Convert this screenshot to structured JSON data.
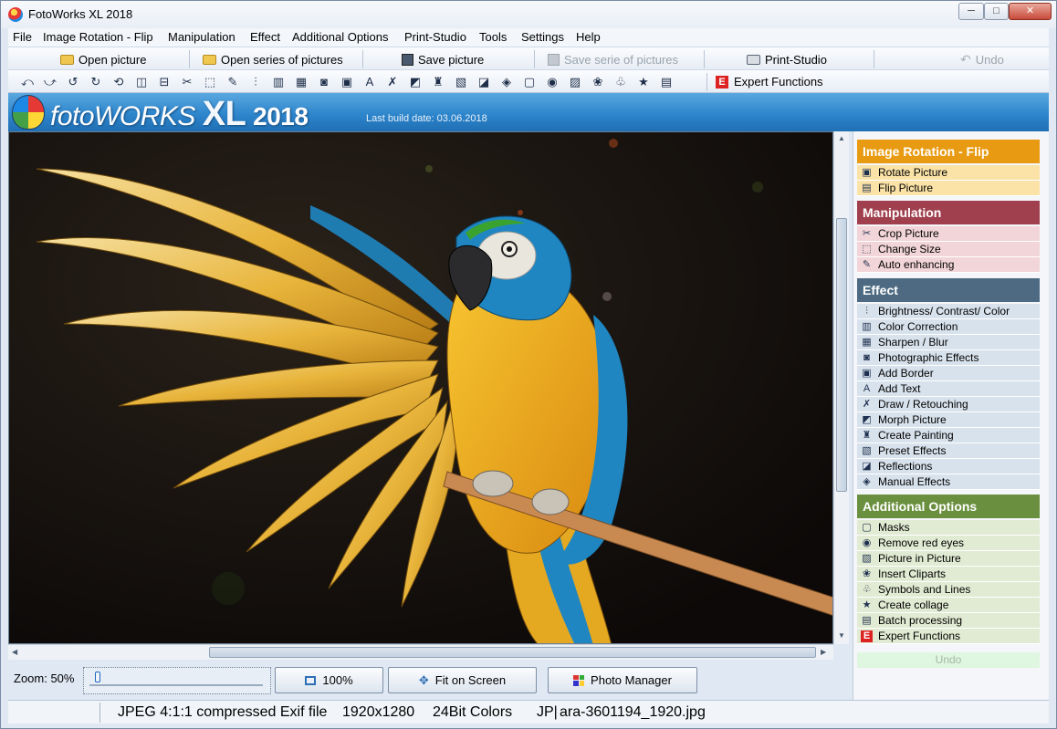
{
  "window": {
    "title": "FotoWorks XL 2018",
    "controls": {
      "minimize": "─",
      "maximize": "□",
      "close": "✕"
    }
  },
  "menu": [
    "File",
    "Image Rotation - Flip",
    "Manipulation",
    "Effect",
    "Additional Options",
    "Print-Studio",
    "Tools",
    "Settings",
    "Help"
  ],
  "toolbar": {
    "open_picture": "Open picture",
    "open_series": "Open series of pictures",
    "save_picture": "Save picture",
    "save_serie": "Save serie of pictures",
    "print_studio": "Print-Studio",
    "undo": "Undo"
  },
  "icon_toolbar": {
    "tools": [
      "rotate-left-icon",
      "rotate-right-icon",
      "rotate-ccw-icon",
      "rotate-cw-icon",
      "rotate-free-icon",
      "flip-icon",
      "flip-vertical-icon",
      "crop-icon",
      "resize-icon",
      "wand-icon",
      "brightness-icon",
      "color-correction-icon",
      "sharpen-icon",
      "photo-effects-icon",
      "border-icon",
      "text-icon",
      "draw-icon",
      "morph-icon",
      "painting-icon",
      "preset-icon",
      "reflection-icon",
      "manual-effects-icon",
      "mask-icon",
      "red-eye-icon",
      "picture-in-picture-icon",
      "clipart-icon",
      "symbols-icon",
      "collage-icon",
      "batch-icon"
    ],
    "expert_label": "Expert Functions",
    "expert_badge": "E"
  },
  "banner": {
    "logo_foto": "foto",
    "logo_works": "WORKS",
    "logo_xl": "XL",
    "logo_year": "2018",
    "build": "Last build date: 03.06.2018"
  },
  "controls": {
    "zoom_label": "Zoom: 50%",
    "zoom_value": 0.03,
    "btn_100": "100%",
    "btn_fit": "Fit on Screen",
    "btn_manager": "Photo Manager"
  },
  "status": {
    "format": "JPEG 4:1:1 compressed Exif file",
    "size": "1920x1280",
    "colors": "24Bit Colors",
    "prefix": "JP|",
    "file": "ara-3601194_1920.jpg"
  },
  "panel": {
    "sections": [
      {
        "title": "Image Rotation - Flip",
        "header_color": "#e89b12",
        "item_color": "#fbe3a7",
        "items": [
          {
            "label": "Rotate Picture",
            "icon": "rotate-picture-icon",
            "glyph": "▣"
          },
          {
            "label": "Flip Picture",
            "icon": "flip-picture-icon",
            "glyph": "▤"
          }
        ]
      },
      {
        "title": "Manipulation",
        "header_color": "#a0404e",
        "item_color": "#f2d5d8",
        "items": [
          {
            "label": "Crop Picture",
            "icon": "scissors-icon",
            "glyph": "✂"
          },
          {
            "label": "Change Size",
            "icon": "resize-icon",
            "glyph": "⬚"
          },
          {
            "label": "Auto enhancing",
            "icon": "wand-icon",
            "glyph": "✎"
          }
        ]
      },
      {
        "title": "Effect",
        "header_color": "#4d6a82",
        "item_color": "#d8e2ec",
        "items": [
          {
            "label": "Brightness/ Contrast/ Color",
            "icon": "sliders-icon",
            "glyph": "⫶"
          },
          {
            "label": "Color Correction",
            "icon": "color-bars-icon",
            "glyph": "▥"
          },
          {
            "label": "Sharpen / Blur",
            "icon": "sharpen-icon",
            "glyph": "▦"
          },
          {
            "label": "Photographic Effects",
            "icon": "camera-icon",
            "glyph": "◙"
          },
          {
            "label": "Add Border",
            "icon": "border-icon",
            "glyph": "▣"
          },
          {
            "label": "Add Text",
            "icon": "text-icon",
            "glyph": "A"
          },
          {
            "label": "Draw / Retouching",
            "icon": "draw-icon",
            "glyph": "✗"
          },
          {
            "label": "Morph Picture",
            "icon": "morph-icon",
            "glyph": "◩"
          },
          {
            "label": "Create Painting",
            "icon": "brush-icon",
            "glyph": "♜"
          },
          {
            "label": "Preset Effects",
            "icon": "preset-icon",
            "glyph": "▧"
          },
          {
            "label": "Reflections",
            "icon": "reflection-icon",
            "glyph": "◪"
          },
          {
            "label": "Manual Effects",
            "icon": "manual-effects-icon",
            "glyph": "◈"
          }
        ]
      },
      {
        "title": "Additional Options",
        "header_color": "#6a8f3e",
        "item_color": "#e1ead2",
        "items": [
          {
            "label": "Masks",
            "icon": "mask-icon",
            "glyph": "▢"
          },
          {
            "label": "Remove red eyes",
            "icon": "eye-icon",
            "glyph": "◉"
          },
          {
            "label": "Picture in Picture",
            "icon": "picture-in-picture-icon",
            "glyph": "▨"
          },
          {
            "label": "Insert Cliparts",
            "icon": "clipart-icon",
            "glyph": "❀"
          },
          {
            "label": "Symbols and Lines",
            "icon": "symbols-icon",
            "glyph": "♧"
          },
          {
            "label": "Create collage",
            "icon": "star-icon",
            "glyph": "★"
          },
          {
            "label": "Batch processing",
            "icon": "batch-icon",
            "glyph": "▤"
          },
          {
            "label": "Expert Functions",
            "icon": "expert-icon",
            "glyph": "E"
          }
        ]
      }
    ],
    "undo": "Undo"
  },
  "colors": {
    "canvas_bg": "#120d0b",
    "parrot_yellow": "#f2b81c",
    "parrot_blue": "#1f86c2",
    "perch": "#c98a52"
  }
}
